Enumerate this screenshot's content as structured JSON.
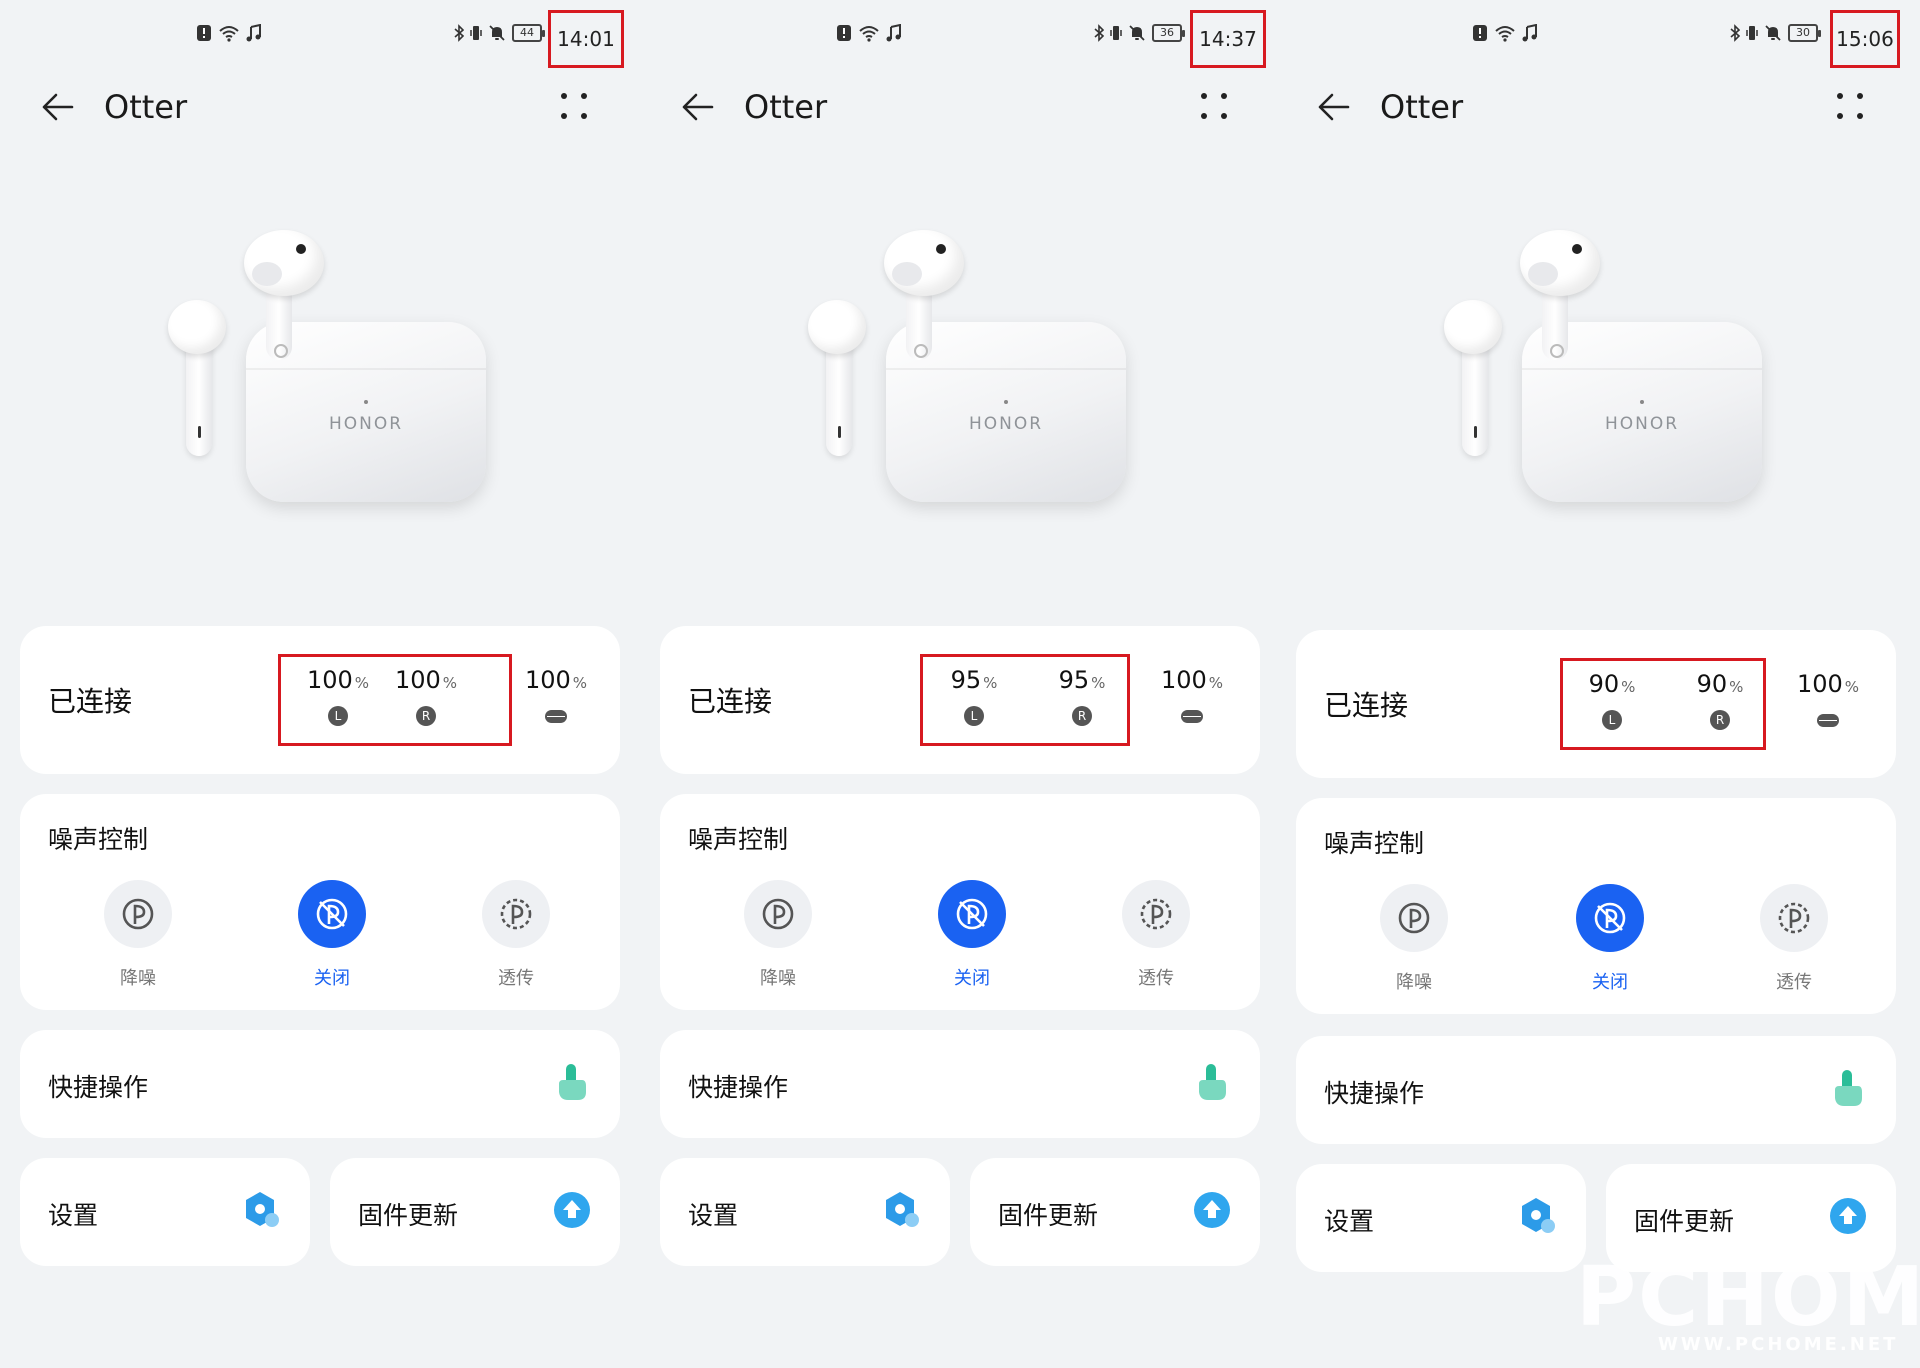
{
  "app": {
    "title": "Otter",
    "connection_label": "已连接",
    "noise_control_label": "噪声控制",
    "noise_modes": [
      "降噪",
      "关闭",
      "透传"
    ],
    "quick_actions_label": "快捷操作",
    "settings_label": "设置",
    "firmware_label": "固件更新",
    "product_logo": "HONOR",
    "percent_sign": "%",
    "left_badge": "L",
    "right_badge": "R"
  },
  "screens": [
    {
      "time": "14:01",
      "phone_battery": "44",
      "left_battery": "100",
      "right_battery": "100",
      "case_battery": "100",
      "active_noise_mode": "关闭"
    },
    {
      "time": "14:37",
      "phone_battery": "36",
      "left_battery": "95",
      "right_battery": "95",
      "case_battery": "100",
      "active_noise_mode": "关闭"
    },
    {
      "time": "15:06",
      "phone_battery": "30",
      "left_battery": "90",
      "right_battery": "90",
      "case_battery": "100",
      "active_noise_mode": "关闭"
    }
  ],
  "colors": {
    "accent": "#1a62f2",
    "highlight_box": "#d71920",
    "background": "#f1f3f5",
    "card": "#ffffff"
  },
  "icons": [
    "back-arrow-icon",
    "more-dots-icon",
    "nfc-icon",
    "wifi-icon",
    "music-icon",
    "bluetooth-icon",
    "vibrate-icon",
    "mute-bell-icon",
    "noise-cancel-icon",
    "noise-off-icon",
    "transparency-icon",
    "touch-gesture-icon",
    "settings-hex-icon",
    "upload-arrow-icon"
  ],
  "watermark": {
    "brand": "PCHOME",
    "site": "WWW.PCHOME.NET"
  }
}
